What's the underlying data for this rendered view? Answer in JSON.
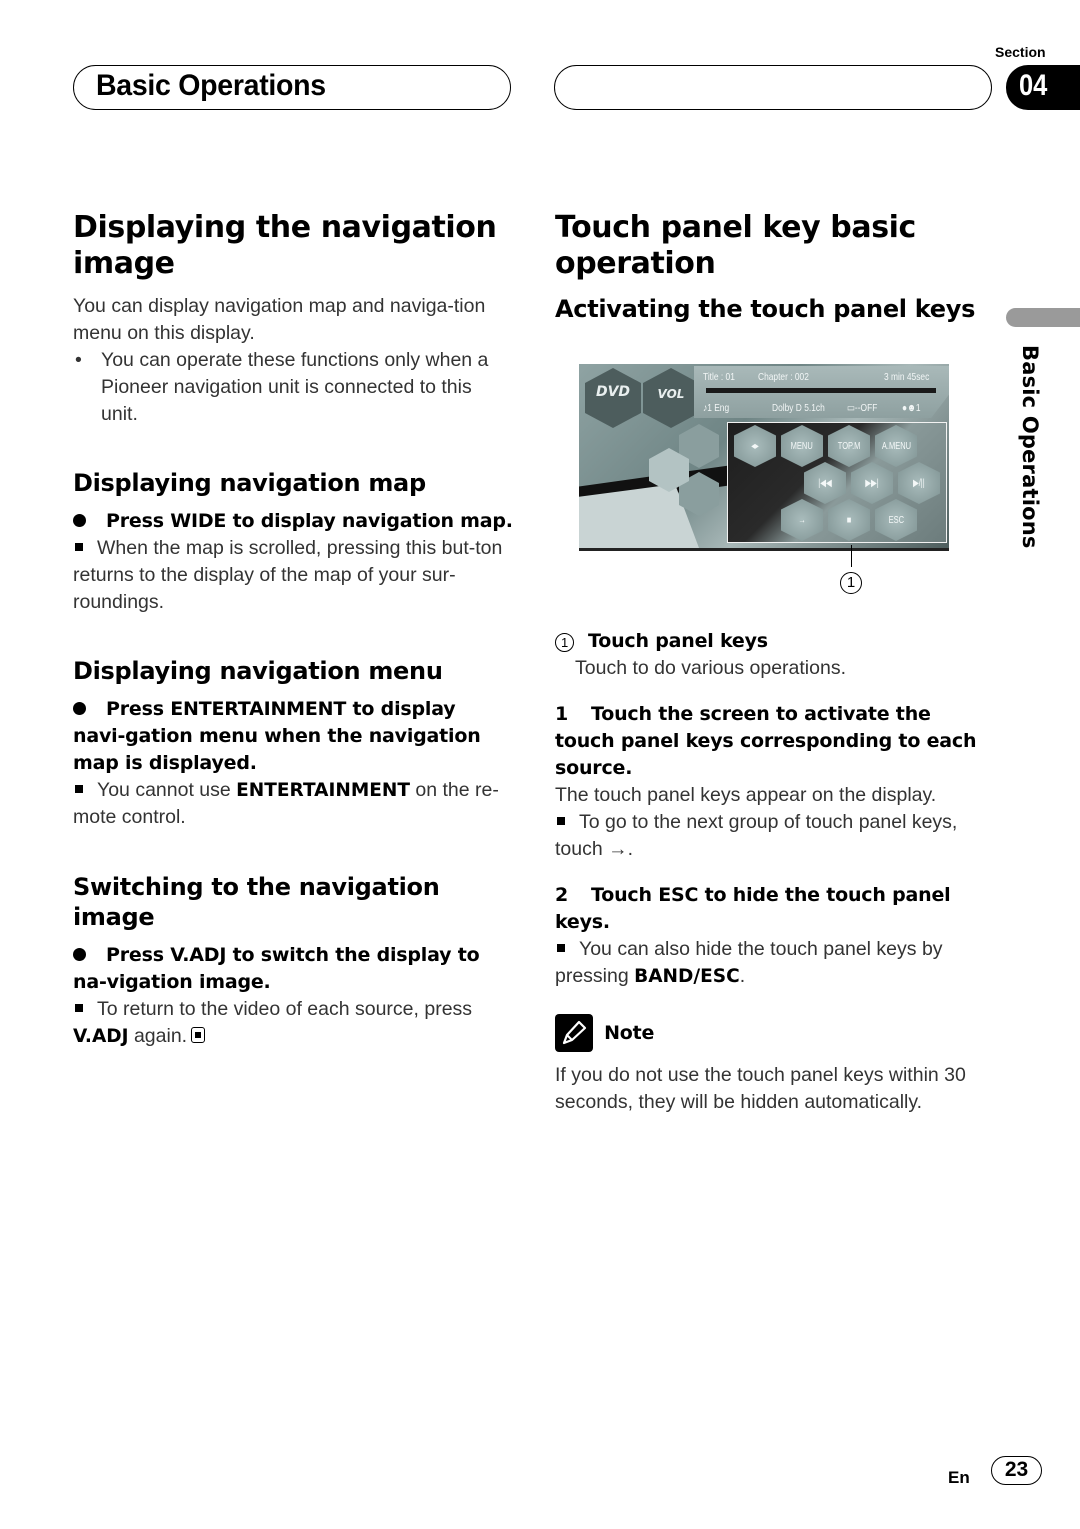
{
  "header": {
    "title": "Basic Operations",
    "section_label": "Section",
    "section_number": "04"
  },
  "side_tab": {
    "label": "Basic Operations"
  },
  "left": {
    "h1": "Displaying the navigation image",
    "intro": "You can display navigation map and naviga-tion menu on this display.",
    "intro_bullet": "You can operate these functions only when a Pioneer navigation unit is connected to this unit.",
    "map": {
      "heading": "Displaying navigation map",
      "step": "Press WIDE to display navigation map.",
      "note": "When the map is scrolled, pressing this but-ton returns to the display of the map of your sur-roundings."
    },
    "menu": {
      "heading": "Displaying navigation menu",
      "step": "Press ENTERTAINMENT to display navi-gation menu when the navigation map is displayed.",
      "note_pre": "You cannot use ",
      "note_bold": "ENTERTAINMENT",
      "note_post": " on the re-mote control."
    },
    "switch": {
      "heading": "Switching to the navigation image",
      "step": "Press V.ADJ to switch the display to na-vigation image.",
      "note_pre": "To return to the video of each source, press ",
      "note_bold": "V.ADJ",
      "note_post": " again."
    }
  },
  "right": {
    "h1": "Touch panel key basic operation",
    "h2": "Activating the touch panel keys",
    "screen": {
      "logo_dvd": "DVD",
      "logo_vol": "VOL",
      "title_info": "Title : 01",
      "chapter_info": "Chapter : 002",
      "time_info": "3 min 45sec",
      "audio_info": "♪1 Eng",
      "dolby_info": "Dolby D 5.1ch",
      "subtitle_info": "▭--OFF",
      "angle_info": "●☻1",
      "keys": [
        {
          "label": "◂▸"
        },
        {
          "label": "MENU"
        },
        {
          "label": "TOP.M"
        },
        {
          "label": "A.MENU"
        },
        {
          "label": "|◀◀"
        },
        {
          "label": "▶▶|"
        },
        {
          "label": "▶/||"
        },
        {
          "label": "→"
        },
        {
          "label": "■"
        },
        {
          "label": "ESC"
        }
      ]
    },
    "callout_number": "1",
    "legend": {
      "number": "1",
      "title": "Touch panel keys",
      "desc": "Touch to do various operations."
    },
    "step1": {
      "num": "1",
      "text": "Touch the screen to activate the touch panel keys corresponding to each source.",
      "body": "The touch panel keys appear on the display.",
      "note": "To go to the next group of touch panel keys, touch →."
    },
    "step2": {
      "num": "2",
      "text": "Touch ESC to hide the touch panel keys.",
      "note_pre": "You can also hide the touch panel keys by pressing ",
      "note_bold": "BAND/ESC",
      "note_post": "."
    },
    "note": {
      "title": "Note",
      "text": "If you do not use the touch panel keys within 30 seconds, they will be hidden automatically."
    }
  },
  "footer": {
    "lang": "En",
    "page": "23"
  }
}
